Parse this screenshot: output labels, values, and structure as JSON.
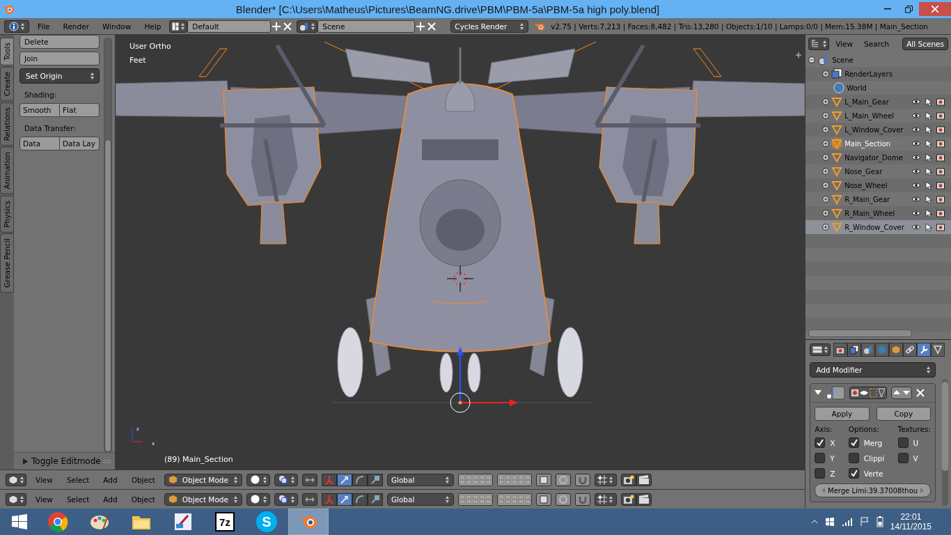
{
  "window": {
    "title": "Blender* [C:\\Users\\Matheus\\Pictures\\BeamNG.drive\\PBM\\PBM-5a\\PBM-5a high poly.blend]"
  },
  "info_header": {
    "menus": [
      "File",
      "Render",
      "Window",
      "Help"
    ],
    "layout": "Default",
    "scene": "Scene",
    "engine": "Cycles Render",
    "stats": "v2.75 | Verts:7,213 | Faces:8,482 | Tris:13,280 | Objects:1/10 | Lamps:0/0 | Mem:15.38M | Main_Section"
  },
  "tool_shelf": {
    "tabs": [
      {
        "label": "Tools",
        "selected": true
      },
      {
        "label": "Create",
        "selected": false
      },
      {
        "label": "Relations",
        "selected": false
      },
      {
        "label": "Animation",
        "selected": false
      },
      {
        "label": "Physics",
        "selected": false
      },
      {
        "label": "Grease Pencil",
        "selected": false
      }
    ],
    "items": [
      {
        "kind": "button",
        "label": "Delete"
      },
      {
        "kind": "button",
        "label": "Join"
      },
      {
        "kind": "dropdown",
        "label": "Set Origin"
      },
      {
        "kind": "heading",
        "label": "Shading:"
      },
      {
        "kind": "pair",
        "labels": [
          "Smooth",
          "Flat"
        ]
      },
      {
        "kind": "heading",
        "label": "Data Transfer:"
      },
      {
        "kind": "pair",
        "labels": [
          "Data",
          "Data Lay"
        ]
      }
    ],
    "operator_panel": {
      "label": "Toggle Editmode",
      "expanded": false
    }
  },
  "viewport": {
    "view_name": "User Ortho",
    "units": "Feet",
    "object_label": "(89) Main_Section",
    "axis_labels": [
      "z",
      "x"
    ]
  },
  "outliner": {
    "menus": [
      "View",
      "Search"
    ],
    "display_mode": "All Scenes",
    "tree": {
      "label": "Scene",
      "kind": "scene",
      "expanded": true,
      "children": [
        {
          "label": "RenderLayers",
          "kind": "renderlayers",
          "selected": false,
          "active": false
        },
        {
          "label": "World",
          "kind": "world",
          "selected": false,
          "active": false
        },
        {
          "label": "L_Main_Gear",
          "kind": "object",
          "selected": false,
          "active": false
        },
        {
          "label": "L_Main_Wheel",
          "kind": "object",
          "selected": false,
          "active": false
        },
        {
          "label": "L_Window_Cover",
          "kind": "object",
          "selected": false,
          "active": false
        },
        {
          "label": "Main_Section",
          "kind": "object",
          "selected": false,
          "active": true
        },
        {
          "label": "Navigator_Dome",
          "kind": "object",
          "selected": false,
          "active": false
        },
        {
          "label": "Nose_Gear",
          "kind": "object",
          "selected": false,
          "active": false
        },
        {
          "label": "Nose_Wheel",
          "kind": "object",
          "selected": false,
          "active": false
        },
        {
          "label": "R_Main_Gear",
          "kind": "object",
          "selected": false,
          "active": false
        },
        {
          "label": "R_Main_Wheel",
          "kind": "object",
          "selected": false,
          "active": false
        },
        {
          "label": "R_Window_Cover",
          "kind": "object",
          "selected": true,
          "active": false
        }
      ]
    }
  },
  "properties": {
    "tabs": [
      {
        "kind": "render",
        "selected": false
      },
      {
        "kind": "layers",
        "selected": false
      },
      {
        "kind": "scene",
        "selected": false
      },
      {
        "kind": "world",
        "selected": false
      },
      {
        "kind": "object",
        "selected": false
      },
      {
        "kind": "constraints",
        "selected": false
      },
      {
        "kind": "modifiers",
        "selected": true
      },
      {
        "kind": "data",
        "selected": false
      }
    ],
    "add_modifier": "Add Modifier",
    "modifier": {
      "expanded": true,
      "buttons": [
        "Apply",
        "Copy"
      ],
      "columns": [
        {
          "heading": "Axis:",
          "options": [
            {
              "label": "X",
              "checked": true
            },
            {
              "label": "Y",
              "checked": false
            },
            {
              "label": "Z",
              "checked": false
            }
          ]
        },
        {
          "heading": "Options:",
          "options": [
            {
              "label": "Merg",
              "checked": true
            },
            {
              "label": "Clippi",
              "checked": false
            },
            {
              "label": "Verte",
              "checked": true
            }
          ]
        },
        {
          "heading": "Textures:",
          "options": [
            {
              "label": "U",
              "checked": false
            },
            {
              "label": "V",
              "checked": false
            }
          ]
        }
      ],
      "merge_field": "Merge Limi:39.37008thou"
    }
  },
  "view_headers": [
    {
      "menus": [
        "View",
        "Select",
        "Add",
        "Object"
      ],
      "mode": "Object Mode",
      "orientation": "Global",
      "manipulators": [
        {
          "selected": false
        },
        {
          "selected": true
        },
        {
          "selected": false
        },
        {
          "selected": false
        }
      ]
    },
    {
      "menus": [
        "View",
        "Select",
        "Add",
        "Object"
      ],
      "mode": "Object Mode",
      "orientation": "Global",
      "manipulators": [
        {
          "selected": false
        },
        {
          "selected": true
        },
        {
          "selected": false
        },
        {
          "selected": false
        }
      ]
    }
  ],
  "taskbar": {
    "apps": [
      {
        "kind": "chrome",
        "selected": false
      },
      {
        "kind": "paint",
        "selected": false
      },
      {
        "kind": "folder",
        "selected": false
      },
      {
        "kind": "drawing",
        "selected": false
      },
      {
        "kind": "archive",
        "label": "7z",
        "selected": false
      },
      {
        "kind": "chat",
        "label": "S",
        "selected": false
      },
      {
        "kind": "blender",
        "selected": true
      }
    ],
    "time": "22:01",
    "date": "14/11/2015"
  }
}
